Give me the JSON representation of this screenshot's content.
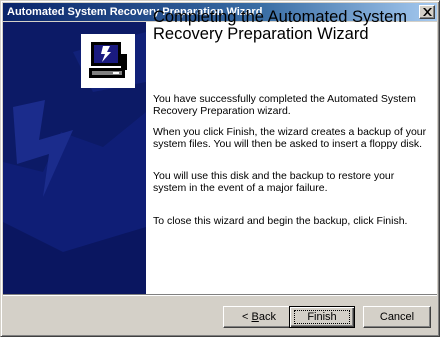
{
  "window": {
    "title": "Automated System Recovery Preparation Wizard",
    "close_label": "×"
  },
  "wizard": {
    "heading": "Completing the Automated System Recovery Preparation Wizard",
    "paragraphs": [
      "You have successfully completed the Automated System Recovery Preparation wizard.",
      "When you click Finish, the wizard creates a backup of your system files. You will then be asked to insert a floppy disk.",
      "You will use this disk and the backup to restore your system in the event of a major failure.",
      "To close this wizard and begin the backup, click Finish."
    ]
  },
  "buttons": {
    "back_prefix": "< ",
    "back_mnemonic": "B",
    "back_rest": "ack",
    "finish": "Finish",
    "cancel": "Cancel"
  },
  "colors": {
    "title_gradient_start": "#0a246a",
    "side_panel": "#0c1a66",
    "face": "#d4d0c8"
  },
  "icons": {
    "app": "computer-recovery-icon",
    "close": "close-icon"
  }
}
